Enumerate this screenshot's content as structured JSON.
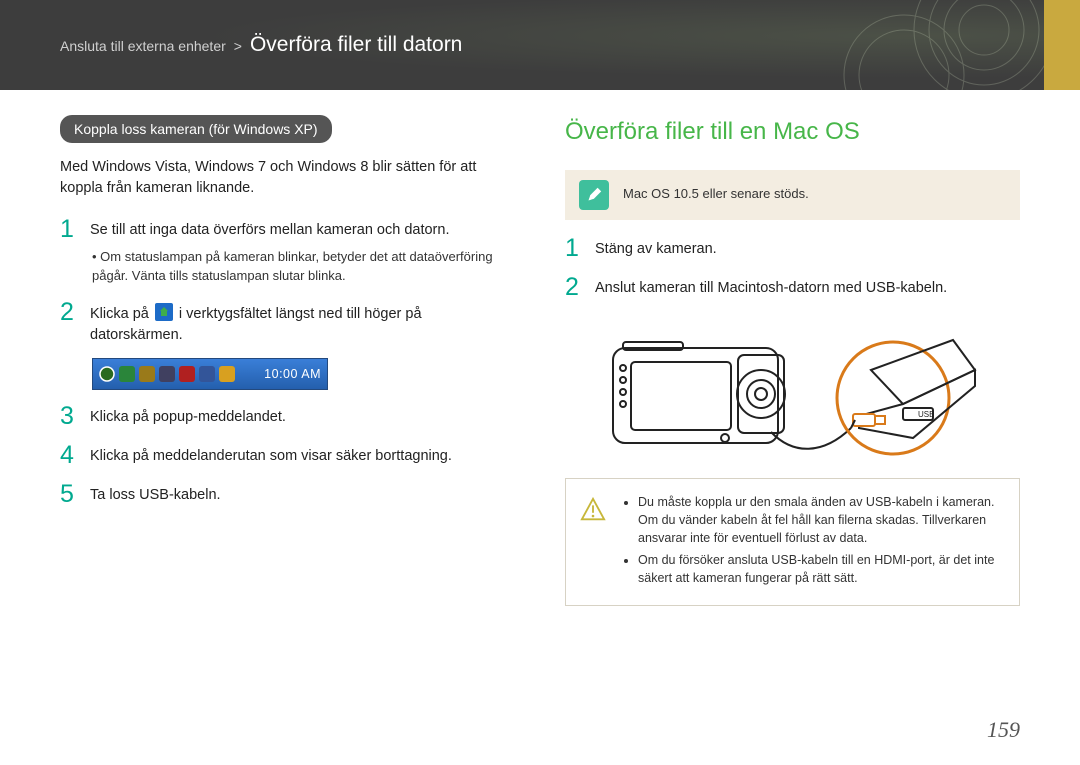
{
  "breadcrumb": {
    "prefix": "Ansluta till externa enheter",
    "sep": ">",
    "title": "Överföra filer till datorn"
  },
  "left": {
    "pill": "Koppla loss kameran (för Windows XP)",
    "intro": "Med Windows Vista, Windows 7 och Windows 8 blir sätten för att koppla från kameran liknande.",
    "steps": {
      "s1": "Se till att inga data överförs mellan kameran och datorn.",
      "s1_bullet": "Om statuslampan på kameran blinkar, betyder det att dataöverföring pågår. Vänta tills statuslampan slutar blinka.",
      "s2_a": "Klicka på ",
      "s2_b": " i verktygsfältet längst ned till höger på datorskärmen.",
      "s3": "Klicka på popup-meddelandet.",
      "s4": "Klicka på meddelanderutan som visar säker borttagning.",
      "s5": "Ta loss USB-kabeln."
    },
    "taskbar": {
      "clock": "10:00 AM"
    }
  },
  "right": {
    "title": "Överföra filer till en Mac OS",
    "note": "Mac OS 10.5 eller senare stöds.",
    "steps": {
      "s1": "Stäng av kameran.",
      "s2": "Anslut kameran till Macintosh-datorn med USB-kabeln."
    },
    "warn": {
      "b1": "Du måste koppla ur den smala änden av USB-kabeln i kameran. Om du vänder kabeln åt fel håll kan filerna skadas. Tillverkaren ansvarar inte för eventuell förlust av data.",
      "b2": "Om du försöker ansluta USB-kabeln till en HDMI-port, är det inte säkert att kameran fungerar på rätt sätt."
    },
    "usb_label": "USB"
  },
  "page_number": "159"
}
